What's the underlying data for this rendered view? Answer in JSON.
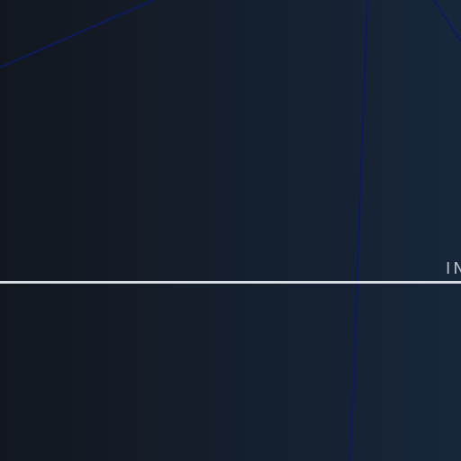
{
  "screen": {
    "background": "#12171f",
    "background_end": "#17263a",
    "line_color": "#0d1b5e",
    "divider_color": "#d8dde3",
    "text_color": "#b9c0c8"
  },
  "edge_text": "IN"
}
